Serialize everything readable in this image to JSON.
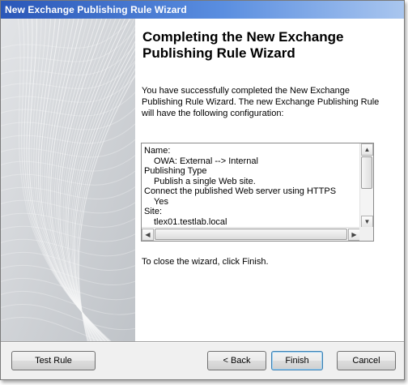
{
  "window": {
    "title": "New Exchange Publishing Rule Wizard"
  },
  "page": {
    "heading": "Completing the New Exchange Publishing Rule Wizard",
    "intro": "You have successfully completed the New Exchange Publishing Rule Wizard. The new Exchange Publishing Rule will have the following configuration:",
    "summary_lines": [
      {
        "text": "Name:",
        "indent": false
      },
      {
        "text": "OWA: External --> Internal",
        "indent": true
      },
      {
        "text": "Publishing Type",
        "indent": false
      },
      {
        "text": "Publish a single Web site.",
        "indent": true
      },
      {
        "text": "Connect the published Web server using HTTPS",
        "indent": false
      },
      {
        "text": "Yes",
        "indent": true
      },
      {
        "text": "Site:",
        "indent": false
      },
      {
        "text": "tlex01.testlab.local",
        "indent": true
      }
    ],
    "closing": "To close the wizard, click Finish."
  },
  "buttons": {
    "test_rule": "Test Rule",
    "back": "< Back",
    "finish": "Finish",
    "cancel": "Cancel"
  },
  "icons": {
    "scroll_up": "scroll-up-arrow-icon",
    "scroll_down": "scroll-down-arrow-icon",
    "scroll_left": "scroll-left-arrow-icon",
    "scroll_right": "scroll-right-arrow-icon"
  },
  "colors": {
    "titlebar": "#2a57b8",
    "panel": "#cfd2d6",
    "default_button_border": "#3c7fb1"
  }
}
